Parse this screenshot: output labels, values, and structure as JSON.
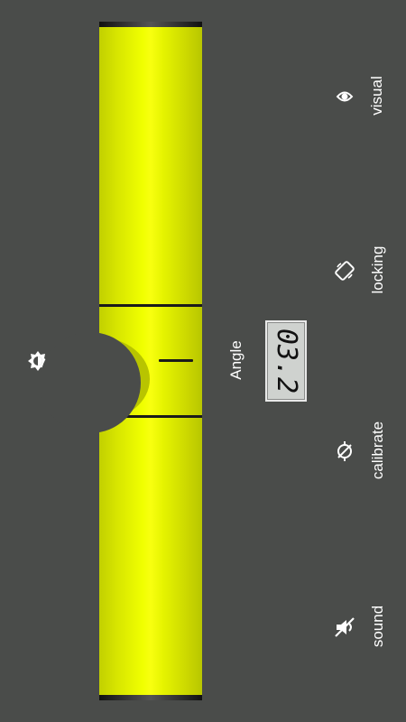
{
  "level": {
    "angle_label": "Angle",
    "angle_value": "03.2"
  },
  "controls": {
    "visual_label": "visual",
    "locking_label": "locking",
    "calibrate_label": "calibrate",
    "sound_label": "sound"
  },
  "icons": {
    "brightness": "brightness-icon",
    "visual": "eye-icon",
    "locking": "screen-rotation-lock-icon",
    "calibrate": "calibrate-icon",
    "sound": "sound-off-icon"
  },
  "colors": {
    "background": "#4a4c4a",
    "tube": "#f0ff00",
    "text": "#ffffff"
  }
}
